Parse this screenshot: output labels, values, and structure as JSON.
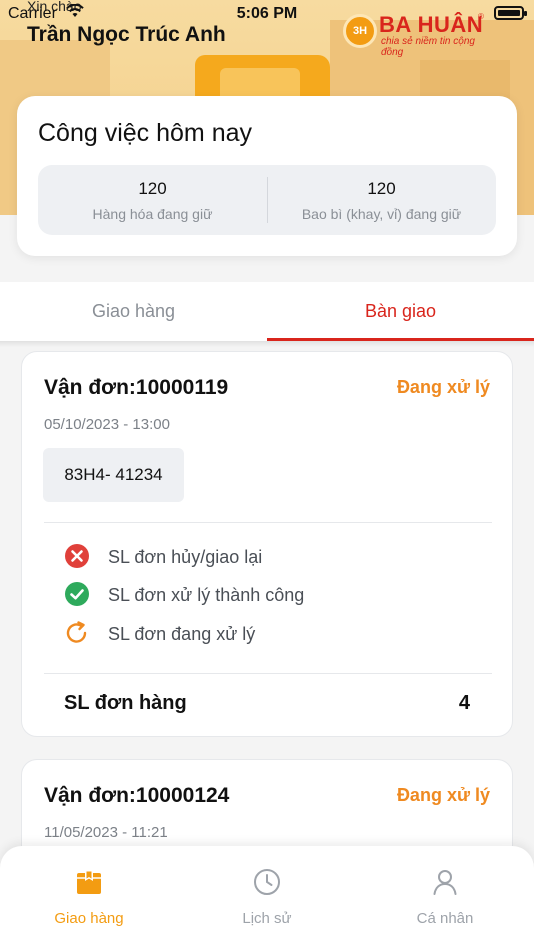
{
  "status_bar": {
    "carrier": "Carrier",
    "time": "5:06 PM"
  },
  "header": {
    "greeting": "Xin chào",
    "user_name": "Trần Ngọc Trúc Anh",
    "logo": {
      "badge": "3H",
      "name": "BA HUÂN",
      "registered": "®",
      "slogan": "chia sẻ niềm tin cộng đồng"
    }
  },
  "summary": {
    "title": "Công việc hôm nay",
    "stats": [
      {
        "value": "120",
        "label": "Hàng hóa đang giữ"
      },
      {
        "value": "120",
        "label": "Bao bì (khay, vỉ) đang giữ"
      }
    ]
  },
  "tabs": [
    {
      "label": "Giao hàng",
      "active": false
    },
    {
      "label": "Bàn giao",
      "active": true
    }
  ],
  "orders": [
    {
      "id": "Vận đơn:10000119",
      "status": "Đang xử lý",
      "datetime": "05/10/2023 - 13:00",
      "plate": "83H4- 41234",
      "legend": [
        {
          "icon": "x-circle-icon",
          "label": "SL đơn hủy/giao lại"
        },
        {
          "icon": "check-circle-icon",
          "label": "SL đơn xử lý thành công"
        },
        {
          "icon": "refresh-icon",
          "label": "SL đơn đang xử lý"
        }
      ],
      "count_label": "SL đơn hàng",
      "count_value": "4"
    },
    {
      "id": "Vận đơn:10000124",
      "status": "Đang xử lý",
      "datetime": "11/05/2023 - 11:21"
    }
  ],
  "bottom_nav": [
    {
      "label": "Giao hàng",
      "icon": "box-icon",
      "active": true
    },
    {
      "label": "Lịch sử",
      "icon": "clock-icon",
      "active": false
    },
    {
      "label": "Cá nhân",
      "icon": "person-icon",
      "active": false
    }
  ],
  "colors": {
    "accent_red": "#d9251c",
    "accent_orange": "#ef8a21",
    "nav_active": "#f39c12",
    "header_bg": "#f7dba0"
  }
}
